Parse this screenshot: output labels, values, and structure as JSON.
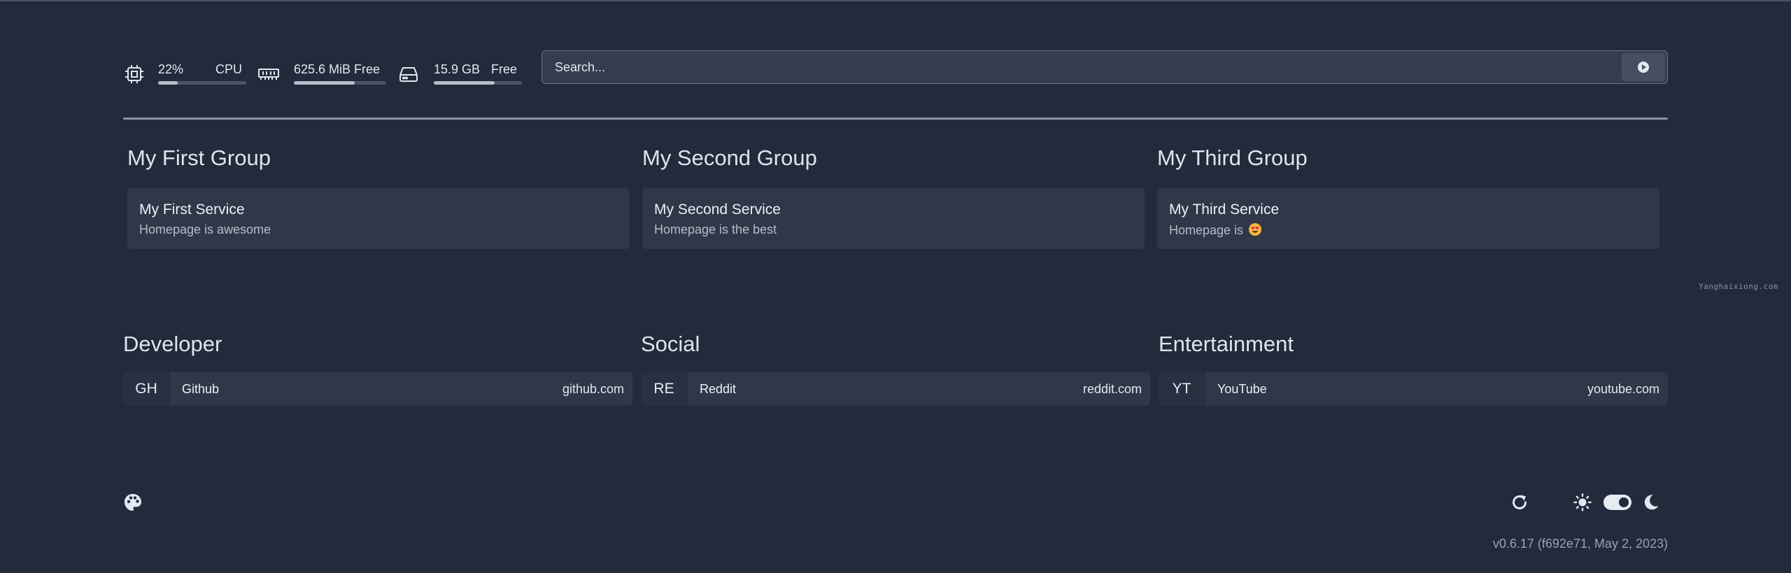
{
  "header": {
    "widgets": {
      "cpu": {
        "icon": "cpu-icon",
        "value": "22%",
        "label": "CPU",
        "usage_percent": 22
      },
      "memory": {
        "icon": "memory-icon",
        "value": "625.6 MiB Free",
        "usage_percent": 66
      },
      "disk": {
        "icon": "hard-drive-icon",
        "value": "15.9 GB",
        "label": "Free",
        "usage_percent": 69
      }
    },
    "search": {
      "placeholder": "Search...",
      "button_icon": "search-engine-icon"
    }
  },
  "service_groups": [
    {
      "title": "My First Group",
      "service": {
        "name": "My First Service",
        "description": "Homepage is awesome"
      }
    },
    {
      "title": "My Second Group",
      "service": {
        "name": "My Second Service",
        "description": "Homepage is the best"
      }
    },
    {
      "title": "My Third Group",
      "service": {
        "name": "My Third Service",
        "description": "Homepage is",
        "emoji": "smiling-face-with-heart-eyes"
      }
    }
  ],
  "watermark": "Yanghaixiong.com",
  "bookmark_groups": [
    {
      "title": "Developer",
      "bookmark": {
        "abbr": "GH",
        "name": "Github",
        "url": "github.com"
      }
    },
    {
      "title": "Social",
      "bookmark": {
        "abbr": "RE",
        "name": "Reddit",
        "url": "reddit.com"
      }
    },
    {
      "title": "Entertainment",
      "bookmark": {
        "abbr": "YT",
        "name": "YouTube",
        "url": "youtube.com"
      }
    }
  ],
  "footer": {
    "theme_icon": "palette-icon",
    "refresh_icon": "refresh-icon",
    "light_icon": "sun-icon",
    "dark_icon": "moon-icon",
    "dark_mode": true,
    "version": "v0.6.17 (f692e71, May 2, 2023)"
  },
  "colors": {
    "background": "#222a3b",
    "card": "#2f3748",
    "text": "#e2e8f0",
    "muted": "#b6bdc9"
  }
}
